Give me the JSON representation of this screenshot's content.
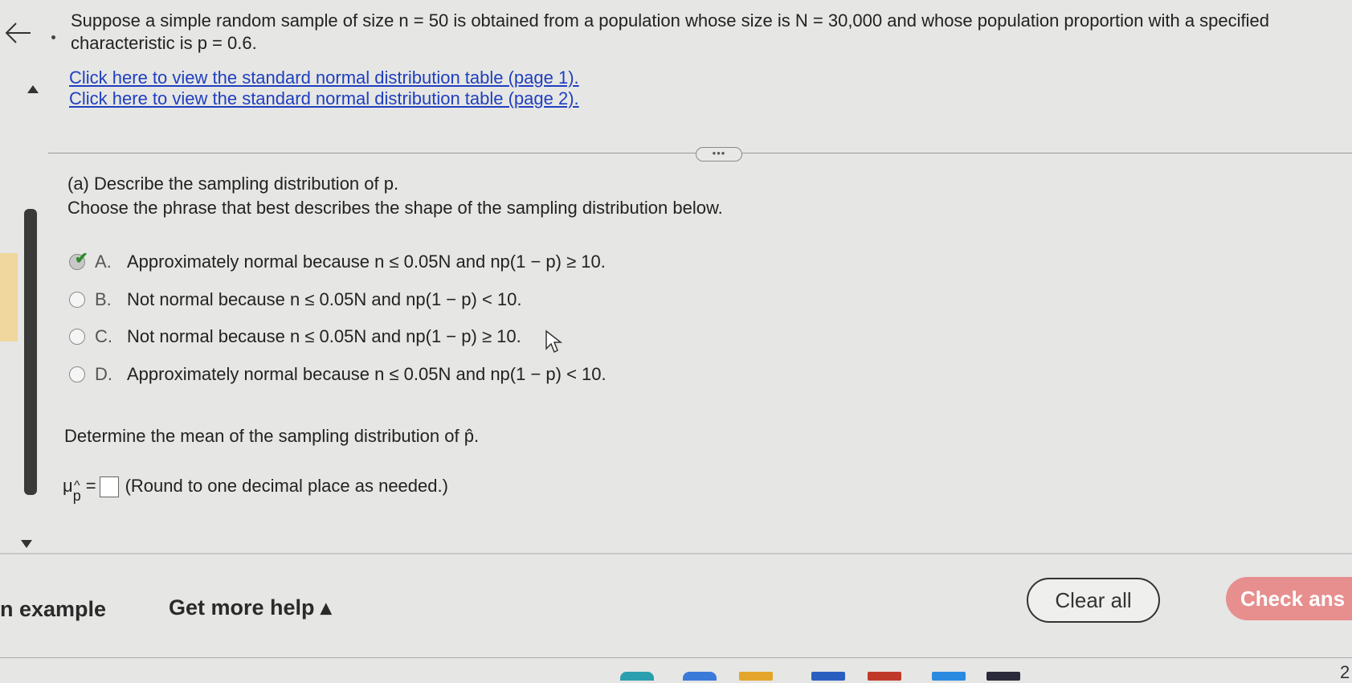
{
  "question": {
    "line1": "Suppose a simple random sample of size n = 50 is obtained from a population whose size is N = 30,000 and whose population proportion with a specified",
    "line2": "characteristic is p = 0.6."
  },
  "links": [
    "Click here to view the standard normal distribution table (page 1).",
    "Click here to view the standard normal distribution table (page 2)."
  ],
  "more_button": "•••",
  "part_a": {
    "title": "(a) Describe the sampling distribution of p.",
    "prompt": "Choose the phrase that best describes the shape of the sampling distribution below.",
    "options": [
      {
        "letter": "A.",
        "text": "Approximately normal because n ≤ 0.05N and np(1 − p) ≥ 10.",
        "selected": true
      },
      {
        "letter": "B.",
        "text": "Not normal because n ≤ 0.05N and np(1 − p) < 10.",
        "selected": false
      },
      {
        "letter": "C.",
        "text": "Not normal because n ≤ 0.05N and np(1 − p) ≥ 10.",
        "selected": false
      },
      {
        "letter": "D.",
        "text": "Approximately normal because n ≤ 0.05N and np(1 − p) < 10.",
        "selected": false
      }
    ]
  },
  "mean_question": "Determine the mean of the sampling distribution of p̂.",
  "mu_label": "μ",
  "mu_sub_top": "^",
  "mu_sub": "p",
  "equals": "=",
  "round_note": "(Round to one decimal place as needed.)",
  "footer": {
    "example": "n example",
    "get_help": "Get more help ▴",
    "clear_all": "Clear all",
    "check_answer": "Check ans"
  },
  "taskbar_number": "2",
  "colors": {
    "link": "#1f3fbf",
    "check_button": "#e78f8f",
    "check_mark": "#2e8b2e"
  }
}
